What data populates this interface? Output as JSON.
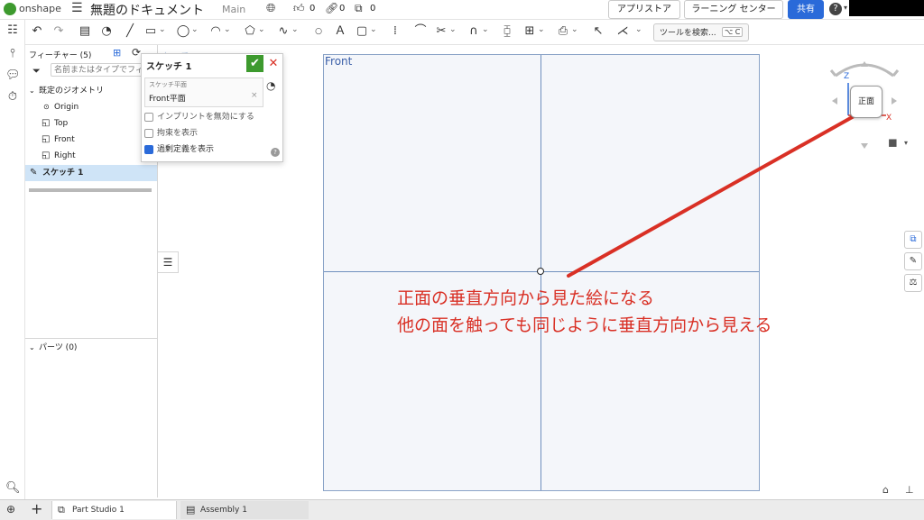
{
  "header": {
    "logo_text": "onshape",
    "doc_title": "無題のドキュメント",
    "branch": "Main",
    "likes": "0",
    "links": "0",
    "copies": "0",
    "app_store": "アプリストア",
    "learning_center": "ラーニング センター",
    "share": "共有",
    "help_icon": "?"
  },
  "toolbar": {
    "search_label": "ツールを検索...",
    "shortcut_keys": "⌥ C"
  },
  "feature_panel": {
    "title": "フィーチャー (5)",
    "search_placeholder": "名前またはタイプでフィ",
    "default_geometry": "既定のジオメトリ",
    "items": [
      {
        "label": "Origin"
      },
      {
        "label": "Top"
      },
      {
        "label": "Front"
      },
      {
        "label": "Right"
      }
    ],
    "sketch_item": "スケッチ 1",
    "parts": "パーツ (0)"
  },
  "sketch_dialog": {
    "name": "スケッチ 1",
    "plane_label": "スケッチ平面",
    "plane_value": "Front平面",
    "options": [
      {
        "label": "インプリントを無効にする",
        "checked": false
      },
      {
        "label": "拘束を表示",
        "checked": false
      },
      {
        "label": "過剰定義を表示",
        "checked": true
      }
    ],
    "help": "?"
  },
  "canvas": {
    "plane_label": "Front",
    "behind_label": "ケッチ 1"
  },
  "view_cube": {
    "face_label": "正面",
    "axis_z": "Z",
    "axis_x": "X"
  },
  "annotation": {
    "line1": "正面の垂直方向から見た絵になる",
    "line2": "他の面を触っても同じように垂直方向から見える"
  },
  "bottom_tabs": [
    {
      "label": "Part Studio 1"
    },
    {
      "label": "Assembly 1"
    }
  ],
  "colors": {
    "accent_blue": "#2a6ad9",
    "confirm_green": "#3d9a2e",
    "cancel_red": "#d93025",
    "annotation_red": "#d93025",
    "selection_blue": "#cfe4f7",
    "plane_blue": "#8aa3c7"
  }
}
